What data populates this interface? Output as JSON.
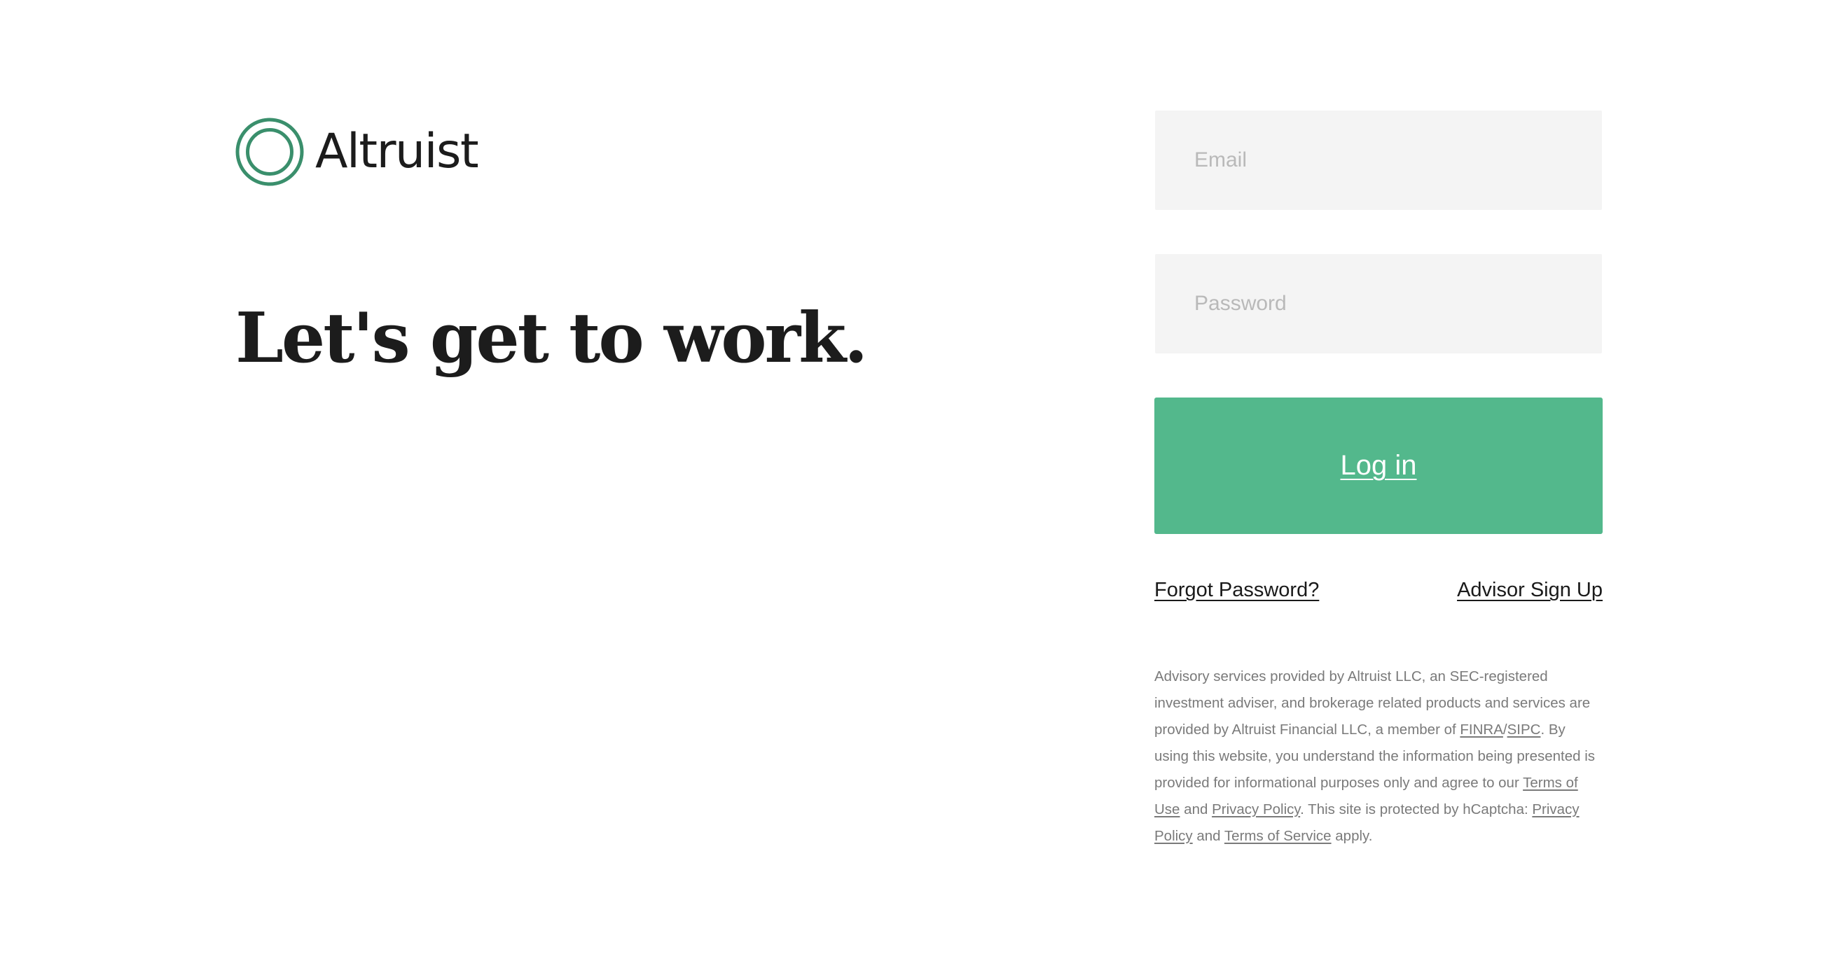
{
  "brand": {
    "name": "Altruist",
    "accent_color": "#3a8f6c",
    "icon": "double-ring-logo"
  },
  "headline": "Let's get to work.",
  "login_form": {
    "email_placeholder": "Email",
    "email_value": "",
    "password_placeholder": "Password",
    "password_value": "",
    "submit_label": "Log in",
    "submit_color": "#53b88c"
  },
  "links": {
    "forgot_password": "Forgot Password?",
    "advisor_sign_up": "Advisor Sign Up"
  },
  "disclaimer": {
    "text_1": "Advisory services provided by Altruist LLC, an SEC-registered investment adviser, and brokerage related products and services are provided by Altruist Financial LLC, a member of ",
    "finra": "FINRA",
    "slash": "/",
    "sipc": "SIPC",
    "text_2": ". By using this website, you understand the information being presented is provided for informational purposes only and agree to our ",
    "terms_of_use": "Terms of Use",
    "and_1": " and ",
    "privacy_policy": "Privacy Policy",
    "text_3": ". This site is protected by hCaptcha: ",
    "hcaptcha_privacy_policy": "Privacy Policy",
    "and_2": " and ",
    "hcaptcha_terms_of_service": "Terms of Service",
    "text_4": " apply."
  }
}
